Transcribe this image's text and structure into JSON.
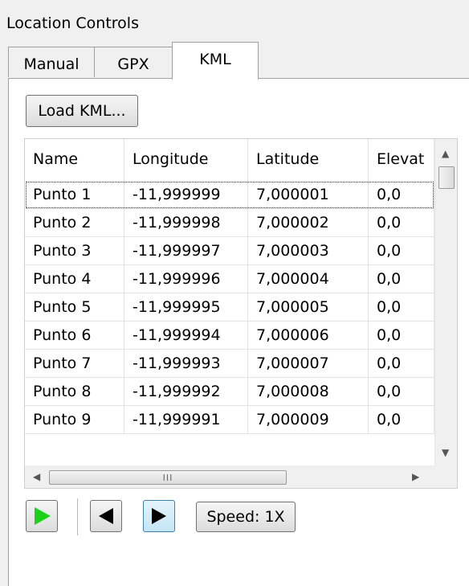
{
  "panel": {
    "title": "Location Controls"
  },
  "tabs": [
    {
      "label": "Manual",
      "active": false
    },
    {
      "label": "GPX",
      "active": false
    },
    {
      "label": "KML",
      "active": true
    }
  ],
  "toolbar": {
    "load_label": "Load KML..."
  },
  "grid": {
    "columns": [
      "Name",
      "Longitude",
      "Latitude",
      "Elevat"
    ],
    "rows": [
      [
        "Punto 1",
        "-11,999999",
        "7,000001",
        "0,0"
      ],
      [
        "Punto 2",
        "-11,999998",
        "7,000002",
        "0,0"
      ],
      [
        "Punto 3",
        "-11,999997",
        "7,000003",
        "0,0"
      ],
      [
        "Punto 4",
        "-11,999996",
        "7,000004",
        "0,0"
      ],
      [
        "Punto 5",
        "-11,999995",
        "7,000005",
        "0,0"
      ],
      [
        "Punto 6",
        "-11,999994",
        "7,000006",
        "0,0"
      ],
      [
        "Punto 7",
        "-11,999993",
        "7,000007",
        "0,0"
      ],
      [
        "Punto 8",
        "-11,999992",
        "7,000008",
        "0,0"
      ],
      [
        "Punto 9",
        "-11,999991",
        "7,000009",
        "0,0"
      ]
    ],
    "selected_row": 0,
    "hscroll_grip": "III"
  },
  "controls": {
    "play_icon": "play-icon",
    "prev_icon": "previous-icon",
    "next_icon": "next-icon",
    "speed_label": "Speed: 1X"
  },
  "colors": {
    "play": "#19d219",
    "arrow": "#000000",
    "selection_bg": "#c4e5f6"
  }
}
